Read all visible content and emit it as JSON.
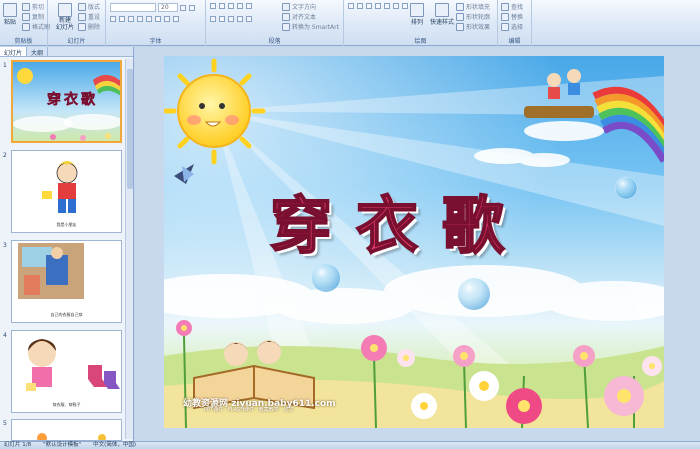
{
  "ribbon": {
    "clipboard": {
      "paste": "粘贴",
      "cut": "剪切",
      "copy": "复制",
      "format_painter": "格式刷",
      "label": "剪贴板"
    },
    "slides": {
      "new_slide": "新建\n幻灯片",
      "layout": "版式",
      "reset": "重设",
      "delete": "删除",
      "label": "幻灯片"
    },
    "font": {
      "font_size": "20",
      "label": "字体"
    },
    "paragraph": {
      "text_direction": "文字方向",
      "align_text": "对齐文本",
      "smartart": "转换为 SmartArt",
      "label": "段落"
    },
    "drawing": {
      "arrange": "排列",
      "quick_styles": "快速样式",
      "shape_fill": "形状填充",
      "shape_outline": "形状轮廓",
      "shape_effects": "形状效果",
      "label": "绘图"
    },
    "editing": {
      "find": "查找",
      "replace": "替换",
      "select": "选择",
      "label": "编辑"
    }
  },
  "pane": {
    "tabs": [
      "幻灯片",
      "大纲"
    ],
    "thumbnails": [
      {
        "num": "1",
        "caption": "穿衣歌"
      },
      {
        "num": "2",
        "caption": "我是小朋友"
      },
      {
        "num": "3",
        "caption": "自己的衣服自己穿"
      },
      {
        "num": "4",
        "caption": "穿衣服、穿鞋子"
      },
      {
        "num": "5",
        "caption": ""
      }
    ]
  },
  "slide": {
    "title": "穿衣歌",
    "logo_text": "幼教资源网 ziyuan.baby611.com",
    "logo_sub": "PPT课件 · FLASH课件 · 教案教学 · 论文"
  },
  "status": {
    "slide_counter": "幻灯片 1/8",
    "theme": "\"默认设计模板\"",
    "language": "中文(简体，中国)"
  },
  "colors": {
    "ribbon_bg": "#dbe7f6",
    "title_pink": "#e03a6c",
    "selected_border": "#f0a83b"
  }
}
